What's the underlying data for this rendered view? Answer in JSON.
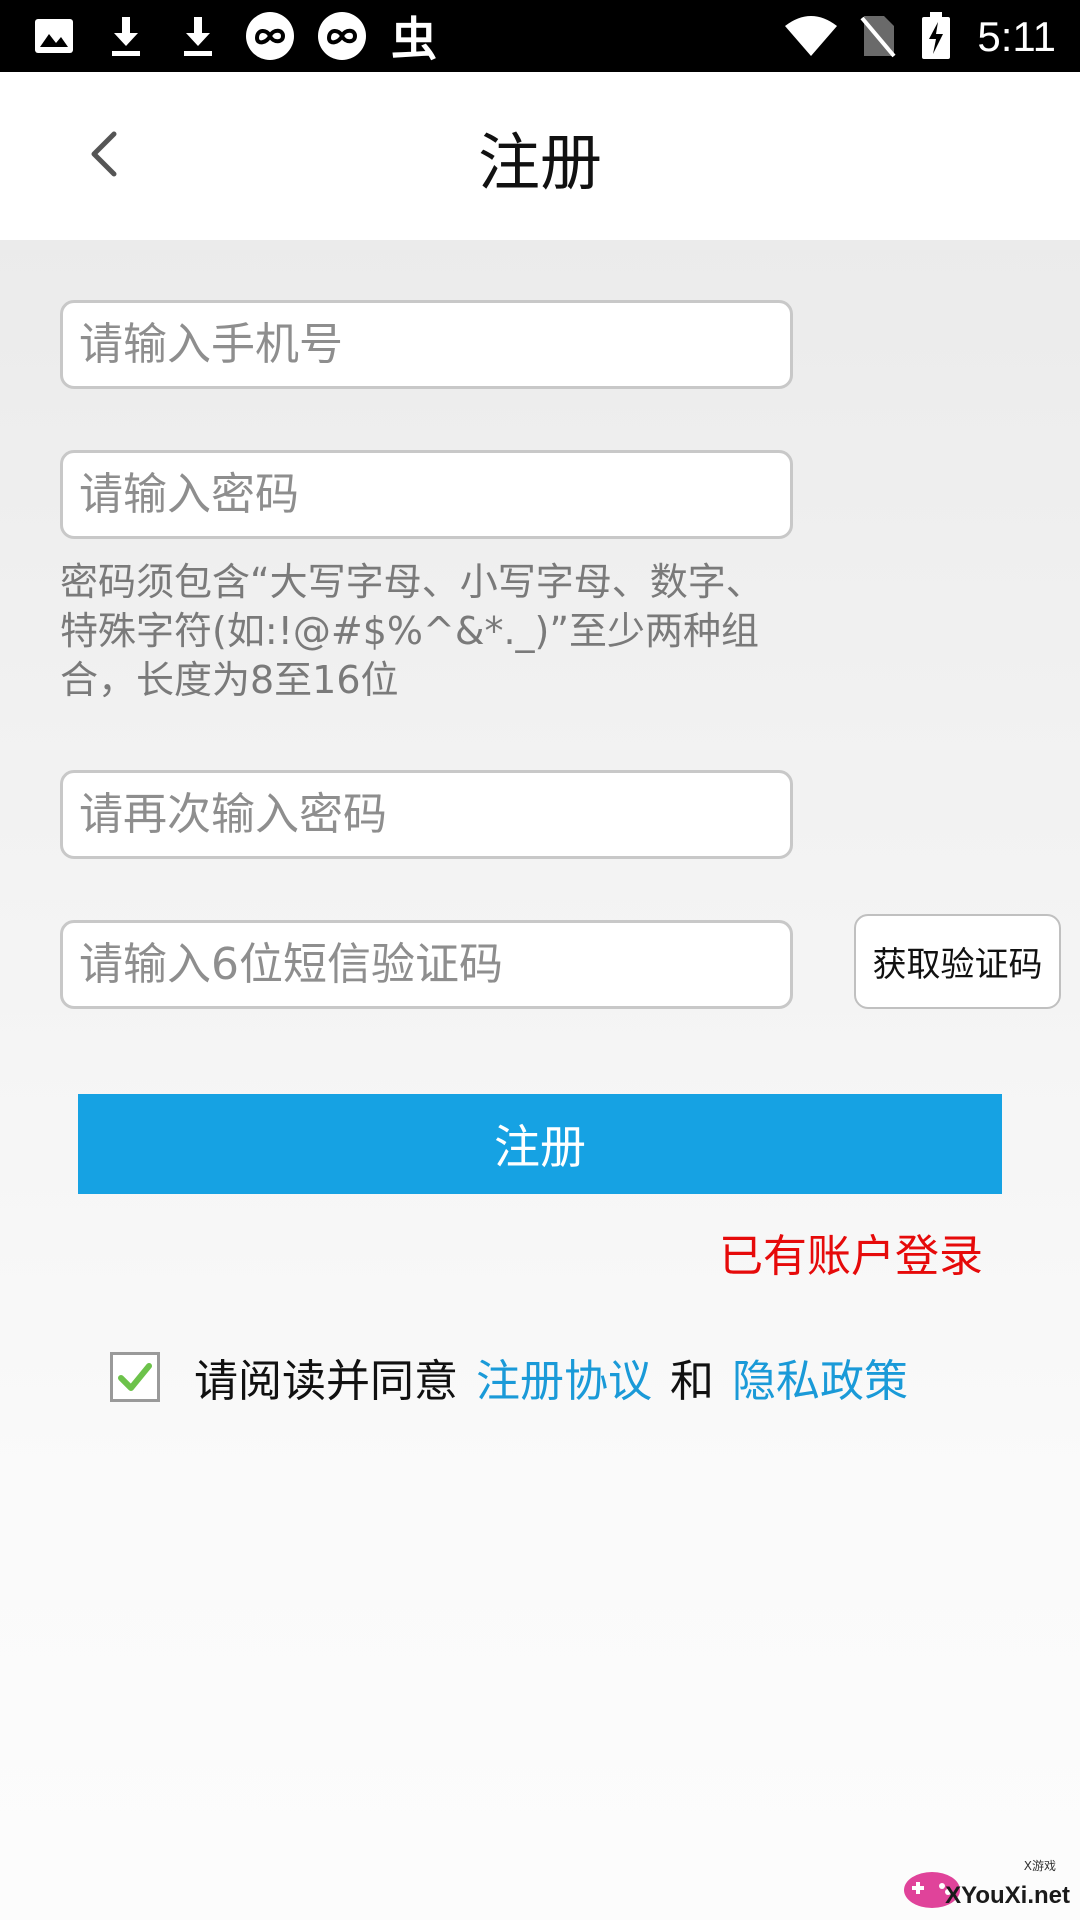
{
  "status_bar": {
    "time": "5:11",
    "left_icons": [
      "image-icon",
      "download-icon",
      "download-icon",
      "infinity-badge-icon",
      "infinity-badge-icon",
      "app-glyph-icon"
    ],
    "app_glyph": "虫",
    "right_icons": [
      "wifi-icon",
      "no-sim-icon",
      "battery-charging-icon"
    ]
  },
  "header": {
    "title": "注册",
    "back_icon": "chevron-left-icon"
  },
  "form": {
    "phone_placeholder": "请输入手机号",
    "password_placeholder": "请输入密码",
    "password_hint": "密码须包含“大写字母、小写字母、数字、特殊字符(如:!@#$%^&*._)”至少两种组合，长度为8至16位",
    "confirm_placeholder": "请再次输入密码",
    "code_placeholder": "请输入6位短信验证码",
    "get_code_label": "获取验证码",
    "submit_label": "注册",
    "login_link": "已有账户登录"
  },
  "agreement": {
    "checked": true,
    "prefix": "请阅读并同意",
    "terms_link": "注册协议",
    "joiner": "和",
    "privacy_link": "隐私政策"
  },
  "watermark": {
    "text": "XYouXi.net",
    "small_text": "X游戏"
  },
  "colors": {
    "accent": "#16a2e3",
    "link": "#1a9ad8",
    "login_red": "#e60a0a",
    "check_green": "#6cc24a"
  }
}
